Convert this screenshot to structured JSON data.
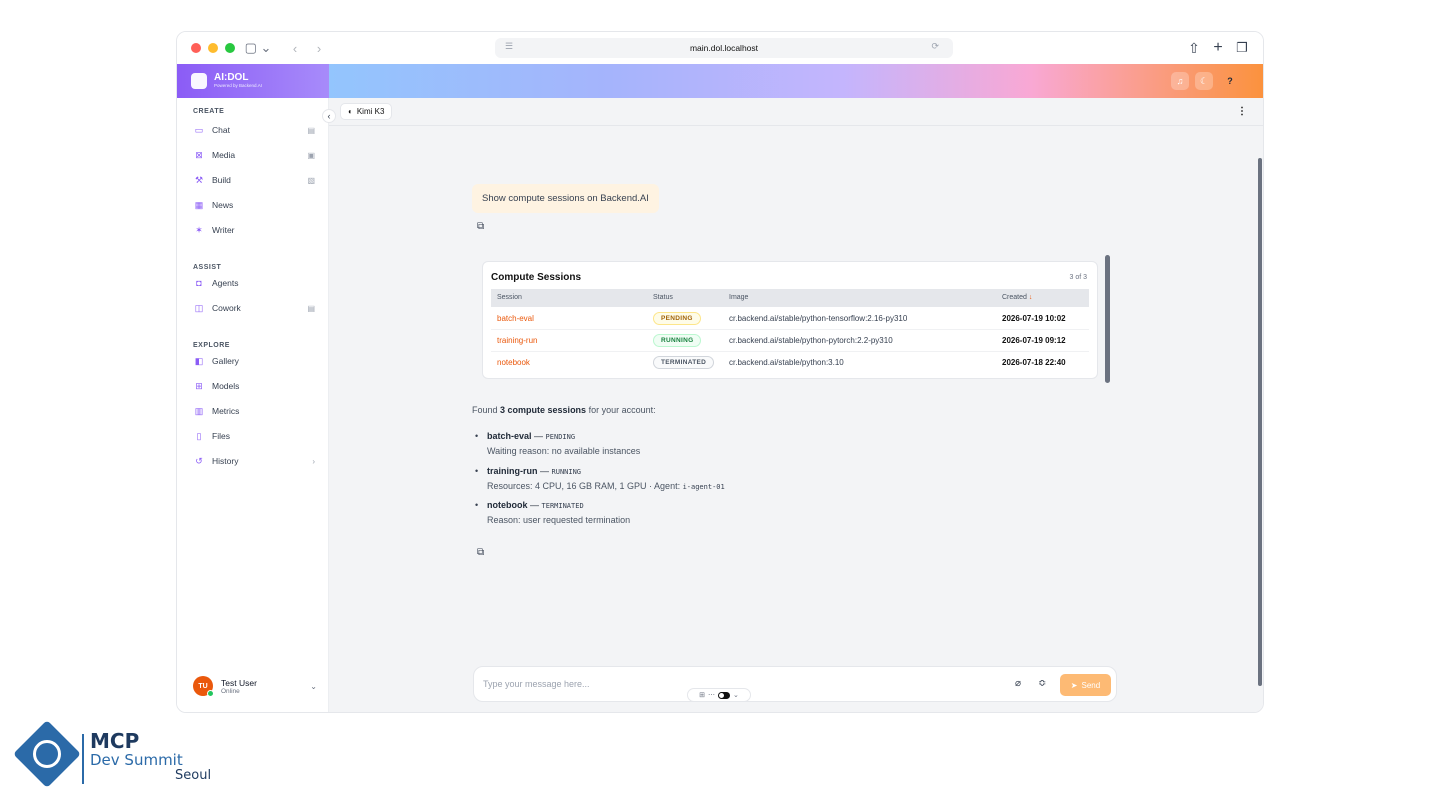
{
  "browser": {
    "url": "main.dol.localhost"
  },
  "brand": {
    "name": "AI:DOL",
    "tagline": "Powered by Backend.AI"
  },
  "sidebar": {
    "sections": {
      "create": "CREATE",
      "assist": "ASSIST",
      "explore": "EXPLORE"
    },
    "items": [
      {
        "label": "Chat",
        "icon": "chat-bubble-icon"
      },
      {
        "label": "Media",
        "icon": "image-icon"
      },
      {
        "label": "Build",
        "icon": "build-icon"
      },
      {
        "label": "News",
        "icon": "newspaper-icon"
      },
      {
        "label": "Writer",
        "icon": "translate-icon"
      },
      {
        "label": "Agents",
        "icon": "robot-icon"
      },
      {
        "label": "Cowork",
        "icon": "book-icon"
      },
      {
        "label": "Gallery",
        "icon": "gallery-icon"
      },
      {
        "label": "Models",
        "icon": "chip-icon"
      },
      {
        "label": "Metrics",
        "icon": "bar-chart-icon"
      },
      {
        "label": "Files",
        "icon": "file-icon"
      },
      {
        "label": "History",
        "icon": "history-icon"
      }
    ],
    "user": {
      "initials": "TU",
      "name": "Test User",
      "status": "Online"
    }
  },
  "topbar": {
    "model": "Kimi K3"
  },
  "chat": {
    "user_message": "Show compute sessions on Backend.AI",
    "table": {
      "title": "Compute Sessions",
      "count": "3 of 3",
      "columns": [
        "Session",
        "Status",
        "Image",
        "Created"
      ],
      "rows": [
        {
          "session": "batch-eval",
          "status": "PENDING",
          "image": "cr.backend.ai/stable/python-tensorflow:2.16-py310",
          "created": "2026-07-19 10:02"
        },
        {
          "session": "training-run",
          "status": "RUNNING",
          "image": "cr.backend.ai/stable/python-pytorch:2.2-py310",
          "created": "2026-07-19 09:12"
        },
        {
          "session": "notebook",
          "status": "TERMINATED",
          "image": "cr.backend.ai/stable/python:3.10",
          "created": "2026-07-18 22:40"
        }
      ]
    },
    "answer": {
      "intro_pre": "Found ",
      "intro_bold": "3 compute sessions",
      "intro_post": " for your account:",
      "bullets": [
        {
          "name": "batch-eval",
          "dash": " — ",
          "status": "PENDING",
          "detail": "Waiting reason: no available instances",
          "agent": ""
        },
        {
          "name": "training-run",
          "dash": " — ",
          "status": "RUNNING",
          "detail": "Resources: 4 CPU, 16 GB RAM, 1 GPU · Agent: ",
          "agent": "i-agent-01"
        },
        {
          "name": "notebook",
          "dash": " — ",
          "status": "TERMINATED",
          "detail": "Reason: user requested termination",
          "agent": ""
        }
      ]
    }
  },
  "composer": {
    "placeholder": "Type your message here...",
    "send_label": "Send"
  },
  "logo": {
    "line1": "MCP",
    "line2": "Dev Summit",
    "line3": "Seoul"
  },
  "colors": {
    "accent": "#8b5cf6",
    "orange": "#ea580c",
    "send": "#fdba74"
  }
}
